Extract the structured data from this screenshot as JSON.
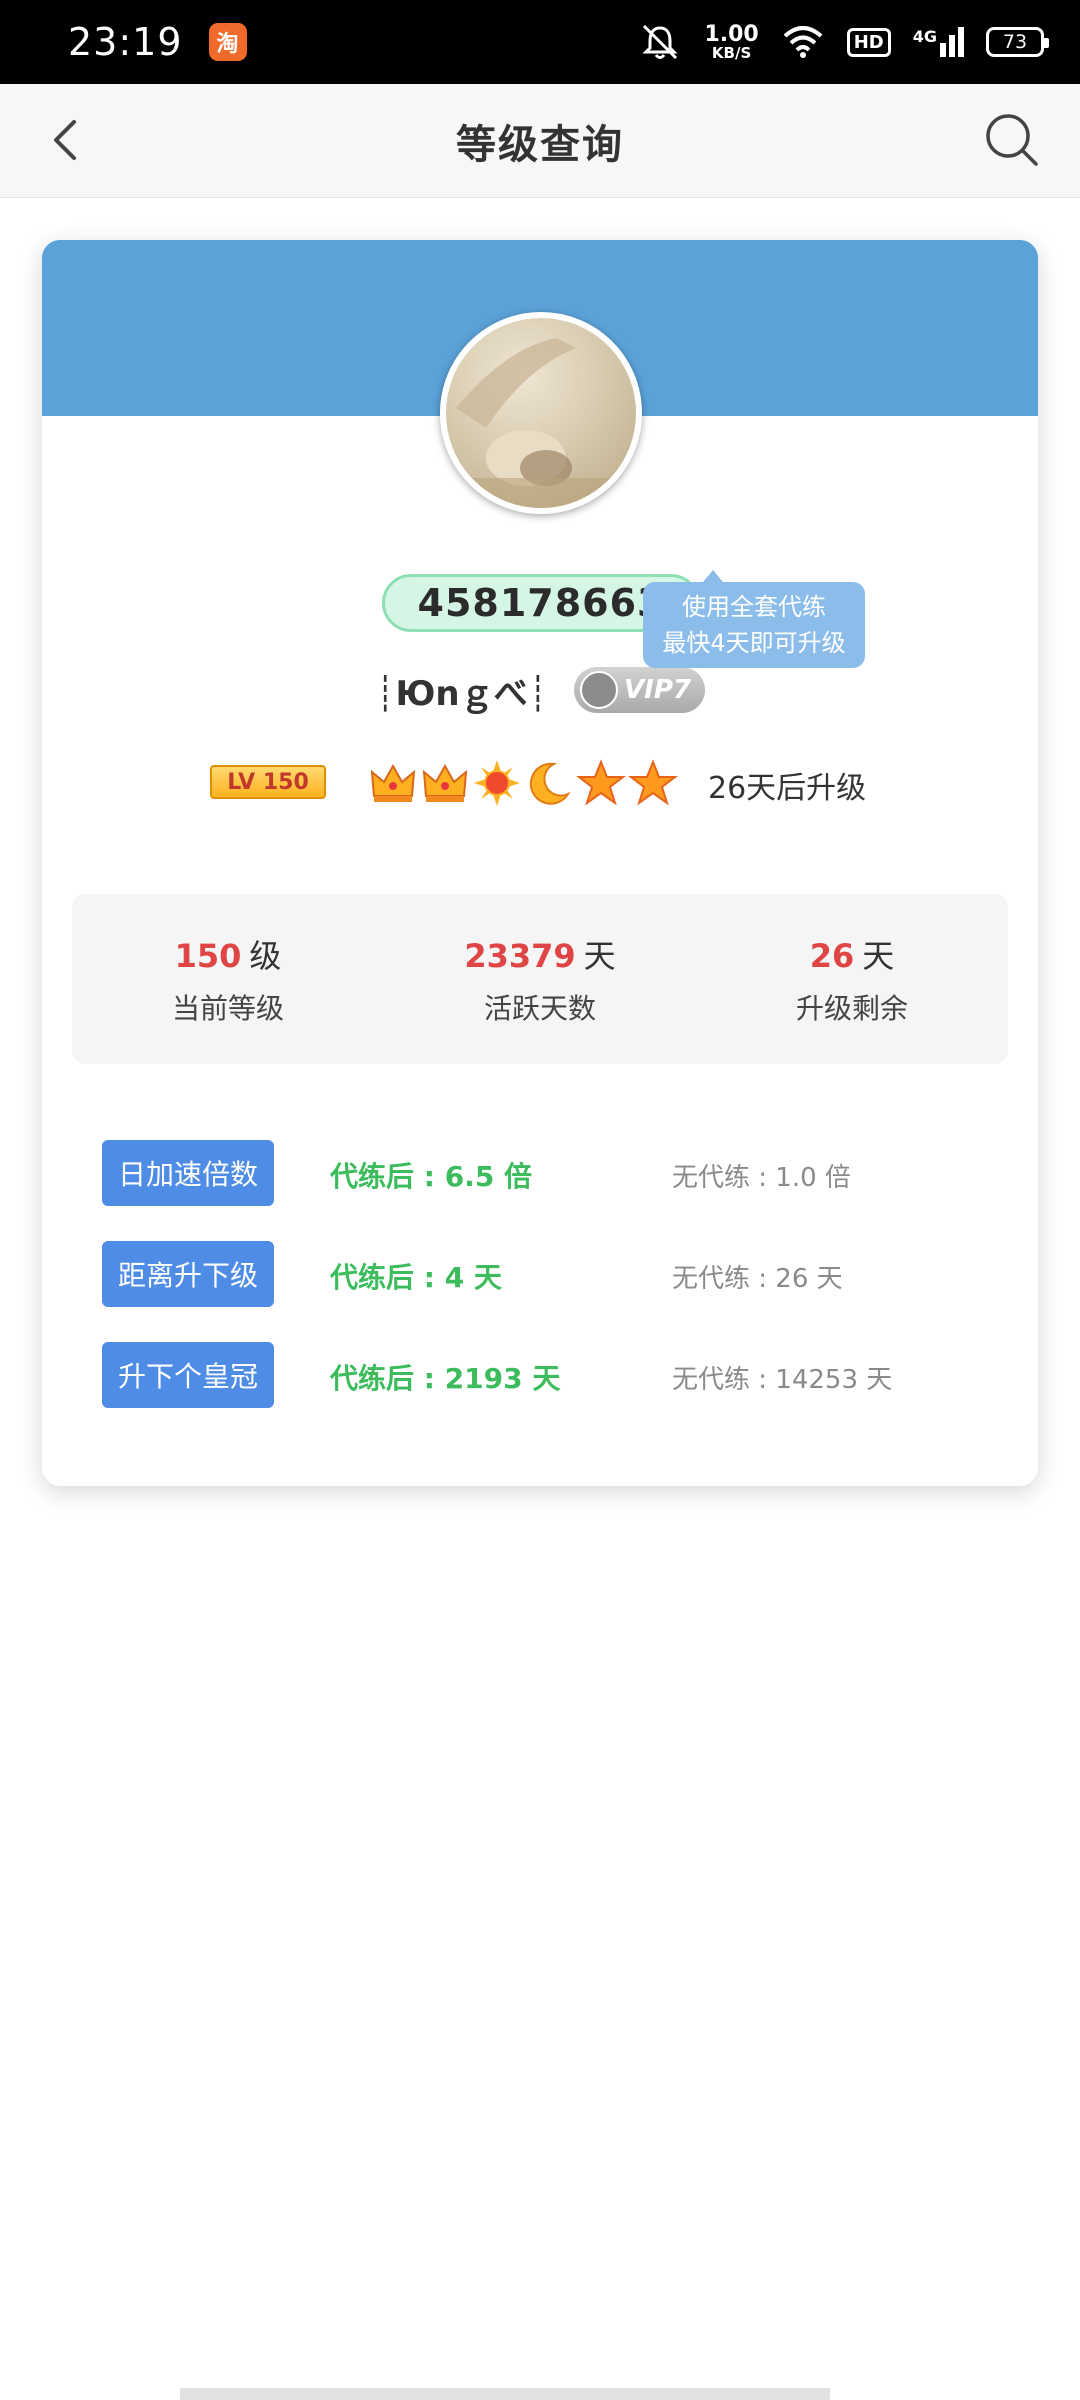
{
  "status_bar": {
    "time": "23:19",
    "app_icon": "taobao-icon",
    "network_speed": "1.00",
    "network_unit": "KB/S",
    "hd_label": "HD",
    "signal_label": "4G",
    "battery": "73"
  },
  "header": {
    "title": "等级查询"
  },
  "profile": {
    "qq_number": "458178663",
    "nickname": "┊Юnｇべ┊",
    "vip_label": "VIP7",
    "lv_badge": "LV 150",
    "level_icons": [
      "crown-icon",
      "crown-icon",
      "sun-icon",
      "moon-icon",
      "star-icon",
      "star-icon"
    ],
    "upgrade_text": "26天后升级",
    "tooltip_line1": "使用全套代练",
    "tooltip_line2": "最快4天即可升级"
  },
  "stats": [
    {
      "value": "150",
      "unit": "级",
      "label": "当前等级"
    },
    {
      "value": "23379",
      "unit": "天",
      "label": "活跃天数"
    },
    {
      "value": "26",
      "unit": "天",
      "label": "升级剩余"
    }
  ],
  "comparisons": [
    {
      "tag": "日加速倍数",
      "boosted": "代练后 : 6.5 倍",
      "normal": "无代练 : 1.0 倍"
    },
    {
      "tag": "距离升下级",
      "boosted": "代练后 : 4 天",
      "normal": "无代练 : 26 天"
    },
    {
      "tag": "升下个皇冠",
      "boosted": "代练后 : 2193 天",
      "normal": "无代练 : 14253 天"
    }
  ],
  "colors": {
    "header_blue": "#5ba2d8",
    "tag_blue": "#4e8ce6",
    "value_red": "#e04545",
    "boost_green": "#3cbc5c",
    "qq_pill_bg": "#d5f5e5"
  }
}
